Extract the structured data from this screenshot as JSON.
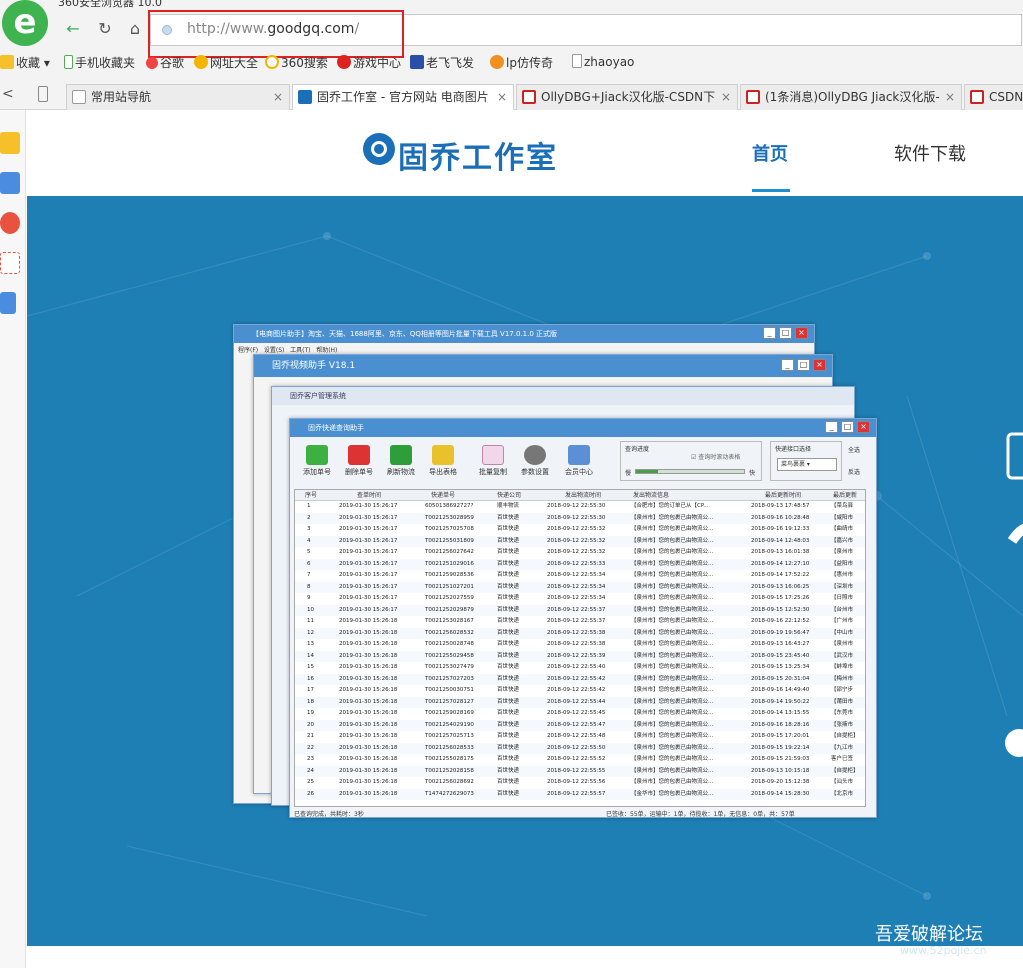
{
  "browser": {
    "logo_char": "e",
    "window_title": "360安全浏览器 10.0",
    "url_prefix": "http://www.",
    "url_domain": "goodgq.com",
    "url_suffix": "/",
    "bookmarks": [
      "收藏",
      "手机收藏夹",
      "谷歌",
      "网址大全",
      "360搜索",
      "游戏中心",
      "老飞飞发",
      "lp仿传奇",
      "zhaoyao"
    ],
    "tabs": [
      "常用站导航",
      "固乔工作室 - 官方网站 电商图片",
      "OllyDBG+Jiack汉化版-CSDN下",
      "(1条消息)OllyDBG Jiack汉化版-",
      "CSDN"
    ]
  },
  "site": {
    "name": "固乔工作室",
    "nav_home": "首页",
    "nav_download": "软件下载"
  },
  "app_windows": {
    "w1_title": "【电商图片助手】淘宝、天猫、1688阿里、京东、QQ相册等图片批量下载工具 V17.0.1.0 正式版",
    "w1_menu": [
      "程序(F)",
      "设置(S)",
      "工具(T)",
      "帮助(H)"
    ],
    "w2_title": "固乔视频助手 V18.1",
    "w3_title": "固乔客户管理系统",
    "w4_title": "固乔快递查询助手",
    "toolbar": [
      "添加单号",
      "删除单号",
      "刷新物流",
      "导出表格",
      "批量复制",
      "参数设置",
      "会员中心"
    ],
    "query_progress_label": "查询进度",
    "auto_scroll_label": "查询时滚动表格",
    "fast_label": "快",
    "slow_label": "慢",
    "api_label": "快递接口选择",
    "api_value": "菜鸟裹裹",
    "select_all": "全选",
    "invert": "反选",
    "columns": [
      "序号",
      "查单时间",
      "快递单号",
      "快递公司",
      "发出物流时间",
      "发出物流信息",
      "最后更新时间",
      "最后更新"
    ],
    "rows": [
      [
        "1",
        "2019-01-30 15:26:17",
        "6050138692727?",
        "顺丰物流",
        "2018-09-12 22:55:30",
        "【合肥市】您的订单已从【CP...",
        "2018-09-13 17:48:57",
        "【菜鸟驿"
      ],
      [
        "2",
        "2019-01-30 15:26:17",
        "T0021253028959",
        "百世快递",
        "2018-09-12 22:55:30",
        "【泉州市】您的包裹已由物流公...",
        "2018-09-16 10:28:48",
        "【咸阳市"
      ],
      [
        "3",
        "2019-01-30 15:26:17",
        "T0021257025708",
        "百世快递",
        "2018-09-12 22:55:32",
        "【泉州市】您的包裹已由物流公...",
        "2018-09-16 19:12:33",
        "【曲靖市"
      ],
      [
        "4",
        "2019-01-30 15:26:17",
        "T0021255031809",
        "百世快递",
        "2018-09-12 22:55:32",
        "【泉州市】您的包裹已由物流公...",
        "2018-09-14 12:48:03",
        "【嘉兴市"
      ],
      [
        "5",
        "2019-01-30 15:26:17",
        "T0021256027642",
        "百世快递",
        "2018-09-12 22:55:32",
        "【泉州市】您的包裹已由物流公...",
        "2018-09-13 16:01:38",
        "【泉州市"
      ],
      [
        "6",
        "2019-01-30 15:26:17",
        "T0021251029016",
        "百世快递",
        "2018-09-12 22:55:33",
        "【泉州市】您的包裹已由物流公...",
        "2018-09-14 12:27:10",
        "【益阳市"
      ],
      [
        "7",
        "2019-01-30 15:26:17",
        "T0021259028536",
        "百世快递",
        "2018-09-12 22:55:34",
        "【泉州市】您的包裹已由物流公...",
        "2018-09-14 17:52:22",
        "【惠州市"
      ],
      [
        "8",
        "2019-01-30 15:26:17",
        "T0021251027201",
        "百世快递",
        "2018-09-12 22:55:34",
        "【泉州市】您的包裹已由物流公...",
        "2018-09-13 16:06:25",
        "【深圳市"
      ],
      [
        "9",
        "2019-01-30 15:26:17",
        "T0021252027559",
        "百世快递",
        "2018-09-12 22:55:34",
        "【泉州市】您的包裹已由物流公...",
        "2018-09-15 17:25:26",
        "【日照市"
      ],
      [
        "10",
        "2019-01-30 15:26:17",
        "T0021252029879",
        "百世快递",
        "2018-09-12 22:55:37",
        "【泉州市】您的包裹已由物流公...",
        "2018-09-15 12:52:30",
        "【台州市"
      ],
      [
        "11",
        "2019-01-30 15:26:18",
        "T0021253028167",
        "百世快递",
        "2018-09-12 22:55:37",
        "【泉州市】您的包裹已由物流公...",
        "2018-09-16 22:12:52",
        "【广州市"
      ],
      [
        "12",
        "2019-01-30 15:26:18",
        "T0021256028532",
        "百世快递",
        "2018-09-12 22:55:38",
        "【泉州市】您的包裹已由物流公...",
        "2018-09-19 19:56:47",
        "【中山市"
      ],
      [
        "13",
        "2019-01-30 15:26:18",
        "T0021250028748",
        "百世快递",
        "2018-09-12 22:55:38",
        "【泉州市】您的包裹已由物流公...",
        "2018-09-13 16:43:27",
        "【泉州市"
      ],
      [
        "14",
        "2019-01-30 15:26:18",
        "T0021255029458",
        "百世快递",
        "2018-09-12 22:55:39",
        "【泉州市】您的包裹已由物流公...",
        "2018-09-15 23:45:40",
        "【武汉市"
      ],
      [
        "15",
        "2019-01-30 15:26:18",
        "T0021253027479",
        "百世快递",
        "2018-09-12 22:55:40",
        "【泉州市】您的包裹已由物流公...",
        "2018-09-15 13:25:34",
        "【蚌埠市"
      ],
      [
        "16",
        "2019-01-30 15:26:18",
        "T0021257027203",
        "百世快递",
        "2018-09-12 22:55:42",
        "【泉州市】您的包裹已由物流公...",
        "2018-09-15 20:31:04",
        "【梅州市"
      ],
      [
        "17",
        "2019-01-30 15:26:18",
        "T0021250030751",
        "百世快递",
        "2018-09-12 22:55:42",
        "【泉州市】您的包裹已由物流公...",
        "2018-09-16 14:49:40",
        "【邵宁步"
      ],
      [
        "18",
        "2019-01-30 15:26:18",
        "T0021257028127",
        "百世快递",
        "2018-09-12 22:55:44",
        "【泉州市】您的包裹已由物流公...",
        "2018-09-14 19:50:22",
        "【莆田市"
      ],
      [
        "19",
        "2019-01-30 15:26:18",
        "T0021259028169",
        "百世快递",
        "2018-09-12 22:55:45",
        "【泉州市】您的包裹已由物流公...",
        "2018-09-14 13:15:55",
        "【东莞市"
      ],
      [
        "20",
        "2019-01-30 15:26:18",
        "T0021254029190",
        "百世快递",
        "2018-09-12 22:55:47",
        "【泉州市】您的包裹已由物流公...",
        "2018-09-16 18:28:16",
        "【张掖市"
      ],
      [
        "21",
        "2019-01-30 15:26:18",
        "T0021257025713",
        "百世快递",
        "2018-09-12 22:55:48",
        "【泉州市】您的包裹已由物流公...",
        "2018-09-15 17:20:01",
        "【自提柜】"
      ],
      [
        "22",
        "2019-01-30 15:26:18",
        "T0021256028533",
        "百世快递",
        "2018-09-12 22:55:50",
        "【泉州市】您的包裹已由物流公...",
        "2018-09-15 19:22:14",
        "【九江市"
      ],
      [
        "23",
        "2019-01-30 15:26:18",
        "T0021255028175",
        "百世快递",
        "2018-09-12 22:55:52",
        "【泉州市】您的包裹已由物流公...",
        "2018-09-15 21:59:03",
        "客户已签"
      ],
      [
        "24",
        "2019-01-30 15:26:18",
        "T0021252028158",
        "百世快递",
        "2018-09-12 22:55:55",
        "【泉州市】您的包裹已由物流公...",
        "2018-09-13 10:15:18",
        "【自提柜】"
      ],
      [
        "25",
        "2019-01-30 15:26:18",
        "T0021256028692",
        "百世快递",
        "2018-09-12 22:55:56",
        "【泉州市】您的包裹已由物流公...",
        "2018-09-20 15:12:38",
        "【汕头市"
      ],
      [
        "26",
        "2019-01-30 15:26:18",
        "T1474272629073",
        "百世快递",
        "2018-09-12 22:55:57",
        "【金华市】您的包裹已由物流公...",
        "2018-09-14 15:28:30",
        "【北京市"
      ]
    ],
    "status_left": "已查询完成，共耗时：3秒",
    "status_right": "已签收：55单，运输中：1单，待揽收：1单，无信息：0单，共：57单"
  },
  "watermark": {
    "main": "吾爱破解论坛",
    "sub": "www.52pojie.cn"
  },
  "colors": {
    "brand": "#1b6fb8",
    "banner": "#1e7fb5",
    "highlight": "#dd2222"
  }
}
